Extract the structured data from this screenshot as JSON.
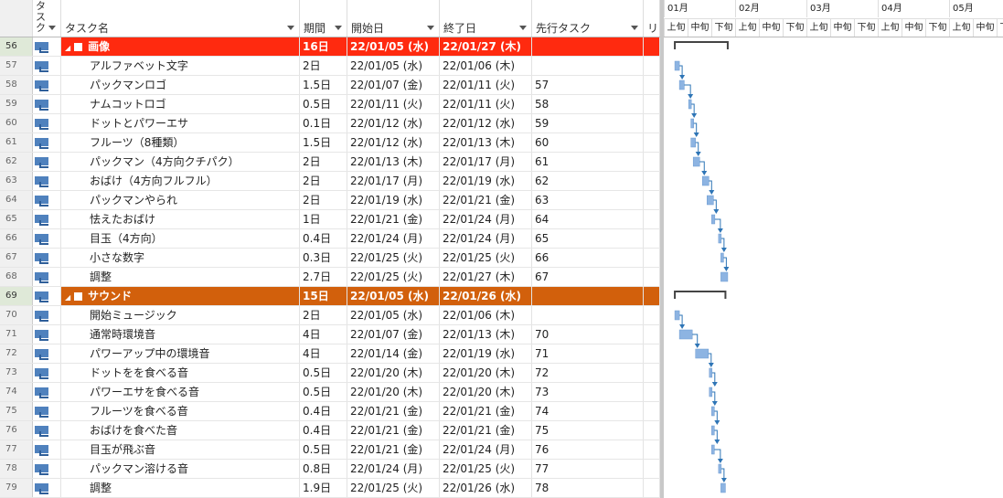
{
  "headers": {
    "mode": "タスク",
    "name": "タスク名",
    "duration": "期間",
    "start": "開始日",
    "finish": "終了日",
    "pred": "先行タスク",
    "res": "リ"
  },
  "timescale": {
    "months": [
      "01月",
      "02月",
      "03月",
      "04月",
      "05月"
    ],
    "periods": [
      "上旬",
      "中旬",
      "下旬"
    ]
  },
  "colors": {
    "summary_red": "#ff2a0f",
    "summary_orange": "#d2600c",
    "bar": "#8db4e2",
    "link": "#2e75b6"
  },
  "tasks": [
    {
      "id": "56",
      "name": "画像",
      "duration": "16日",
      "start": "22/01/05 (水)",
      "finish": "22/01/27 (木)",
      "pred": "",
      "summary": "red"
    },
    {
      "id": "57",
      "name": "アルファベット文字",
      "duration": "2日",
      "start": "22/01/05 (水)",
      "finish": "22/01/06 (木)",
      "pred": ""
    },
    {
      "id": "58",
      "name": "パックマンロゴ",
      "duration": "1.5日",
      "start": "22/01/07 (金)",
      "finish": "22/01/11 (火)",
      "pred": "57"
    },
    {
      "id": "59",
      "name": "ナムコットロゴ",
      "duration": "0.5日",
      "start": "22/01/11 (火)",
      "finish": "22/01/11 (火)",
      "pred": "58"
    },
    {
      "id": "60",
      "name": "ドットとパワーエサ",
      "duration": "0.1日",
      "start": "22/01/12 (水)",
      "finish": "22/01/12 (水)",
      "pred": "59"
    },
    {
      "id": "61",
      "name": "フルーツ（8種類）",
      "duration": "1.5日",
      "start": "22/01/12 (水)",
      "finish": "22/01/13 (木)",
      "pred": "60"
    },
    {
      "id": "62",
      "name": "パックマン（4方向クチパク）",
      "duration": "2日",
      "start": "22/01/13 (木)",
      "finish": "22/01/17 (月)",
      "pred": "61"
    },
    {
      "id": "63",
      "name": "おばけ（4方向フルフル）",
      "duration": "2日",
      "start": "22/01/17 (月)",
      "finish": "22/01/19 (水)",
      "pred": "62"
    },
    {
      "id": "64",
      "name": "パックマンやられ",
      "duration": "2日",
      "start": "22/01/19 (水)",
      "finish": "22/01/21 (金)",
      "pred": "63"
    },
    {
      "id": "65",
      "name": "怯えたおばけ",
      "duration": "1日",
      "start": "22/01/21 (金)",
      "finish": "22/01/24 (月)",
      "pred": "64"
    },
    {
      "id": "66",
      "name": "目玉（4方向）",
      "duration": "0.4日",
      "start": "22/01/24 (月)",
      "finish": "22/01/24 (月)",
      "pred": "65"
    },
    {
      "id": "67",
      "name": "小さな数字",
      "duration": "0.3日",
      "start": "22/01/25 (火)",
      "finish": "22/01/25 (火)",
      "pred": "66"
    },
    {
      "id": "68",
      "name": "調整",
      "duration": "2.7日",
      "start": "22/01/25 (火)",
      "finish": "22/01/27 (木)",
      "pred": "67"
    },
    {
      "id": "69",
      "name": "サウンド",
      "duration": "15日",
      "start": "22/01/05 (水)",
      "finish": "22/01/26 (水)",
      "pred": "",
      "summary": "orange"
    },
    {
      "id": "70",
      "name": "開始ミュージック",
      "duration": "2日",
      "start": "22/01/05 (水)",
      "finish": "22/01/06 (木)",
      "pred": ""
    },
    {
      "id": "71",
      "name": "通常時環境音",
      "duration": "4日",
      "start": "22/01/07 (金)",
      "finish": "22/01/13 (木)",
      "pred": "70"
    },
    {
      "id": "72",
      "name": "パワーアップ中の環境音",
      "duration": "4日",
      "start": "22/01/14 (金)",
      "finish": "22/01/19 (水)",
      "pred": "71"
    },
    {
      "id": "73",
      "name": "ドットをを食べる音",
      "duration": "0.5日",
      "start": "22/01/20 (木)",
      "finish": "22/01/20 (木)",
      "pred": "72"
    },
    {
      "id": "74",
      "name": "パワーエサを食べる音",
      "duration": "0.5日",
      "start": "22/01/20 (木)",
      "finish": "22/01/20 (木)",
      "pred": "73"
    },
    {
      "id": "75",
      "name": "フルーツを食べる音",
      "duration": "0.4日",
      "start": "22/01/21 (金)",
      "finish": "22/01/21 (金)",
      "pred": "74"
    },
    {
      "id": "76",
      "name": "おばけを食べた音",
      "duration": "0.4日",
      "start": "22/01/21 (金)",
      "finish": "22/01/21 (金)",
      "pred": "75"
    },
    {
      "id": "77",
      "name": "目玉が飛ぶ音",
      "duration": "0.5日",
      "start": "22/01/21 (金)",
      "finish": "22/01/24 (月)",
      "pred": "76"
    },
    {
      "id": "78",
      "name": "パックマン溶ける音",
      "duration": "0.8日",
      "start": "22/01/24 (月)",
      "finish": "22/01/25 (火)",
      "pred": "77"
    },
    {
      "id": "79",
      "name": "調整",
      "duration": "1.9日",
      "start": "22/01/25 (火)",
      "finish": "22/01/26 (水)",
      "pred": "78"
    }
  ]
}
